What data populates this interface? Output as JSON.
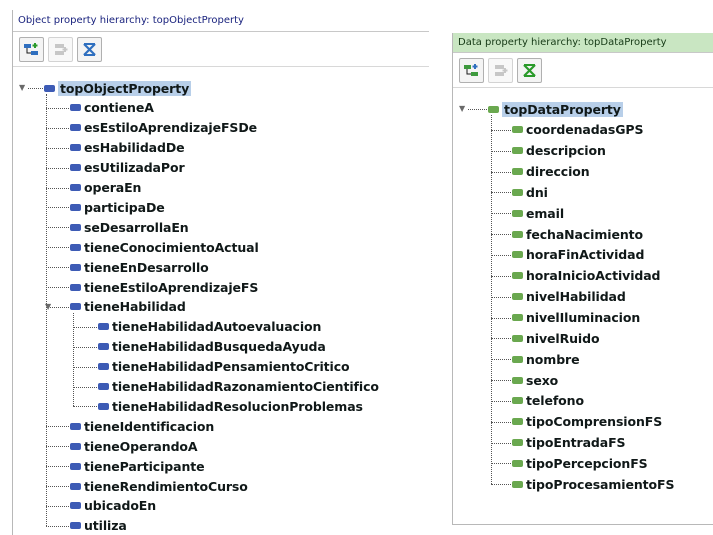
{
  "object_panel": {
    "title": "Object property hierarchy: topObjectProperty",
    "toolbar": [
      {
        "name": "add-sub-property-icon",
        "enabled": true
      },
      {
        "name": "add-sibling-property-icon",
        "enabled": false
      },
      {
        "name": "delete-property-icon",
        "enabled": true
      }
    ],
    "root": "topObjectProperty",
    "children": [
      "contieneA",
      "esEstiloAprendizajeFSDe",
      "esHabilidadDe",
      "esUtilizadaPor",
      "operaEn",
      "participaDe",
      "seDesarrollaEn",
      "tieneConocimientoActual",
      "tieneEnDesarrollo",
      "tieneEstiloAprendizajeFS",
      "tieneHabilidad"
    ],
    "tieneHabilidad_children": [
      "tieneHabilidadAutoevaluacion",
      "tieneHabilidadBusquedaAyuda",
      "tieneHabilidadPensamientoCritico",
      "tieneHabilidadRazonamientoCientifico",
      "tieneHabilidadResolucionProblemas"
    ],
    "more_children": [
      "tieneIdentificacion",
      "tieneOperandoA",
      "tieneParticipante",
      "tieneRendimientoCurso",
      "ubicadoEn",
      "utiliza"
    ]
  },
  "data_panel": {
    "title": "Data property hierarchy: topDataProperty",
    "toolbar": [
      {
        "name": "add-sub-property-icon",
        "enabled": true
      },
      {
        "name": "add-sibling-property-icon",
        "enabled": false
      },
      {
        "name": "delete-property-icon",
        "enabled": true
      }
    ],
    "root": "topDataProperty",
    "children": [
      "coordenadasGPS",
      "descripcion",
      "direccion",
      "dni",
      "email",
      "fechaNacimiento",
      "horaFinActividad",
      "horaInicioActividad",
      "nivelHabilidad",
      "nivelIluminacion",
      "nivelRuido",
      "nombre",
      "sexo",
      "telefono",
      "tipoComprensionFS",
      "tipoEntradaFS",
      "tipoPercepcionFS",
      "tipoProcesamientoFS"
    ]
  },
  "colors": {
    "object_bullet": "#3d5bb5",
    "data_bullet": "#6aa84f",
    "root_highlight": "#b8cfe9",
    "data_header_bg": "#c9e6c2"
  }
}
